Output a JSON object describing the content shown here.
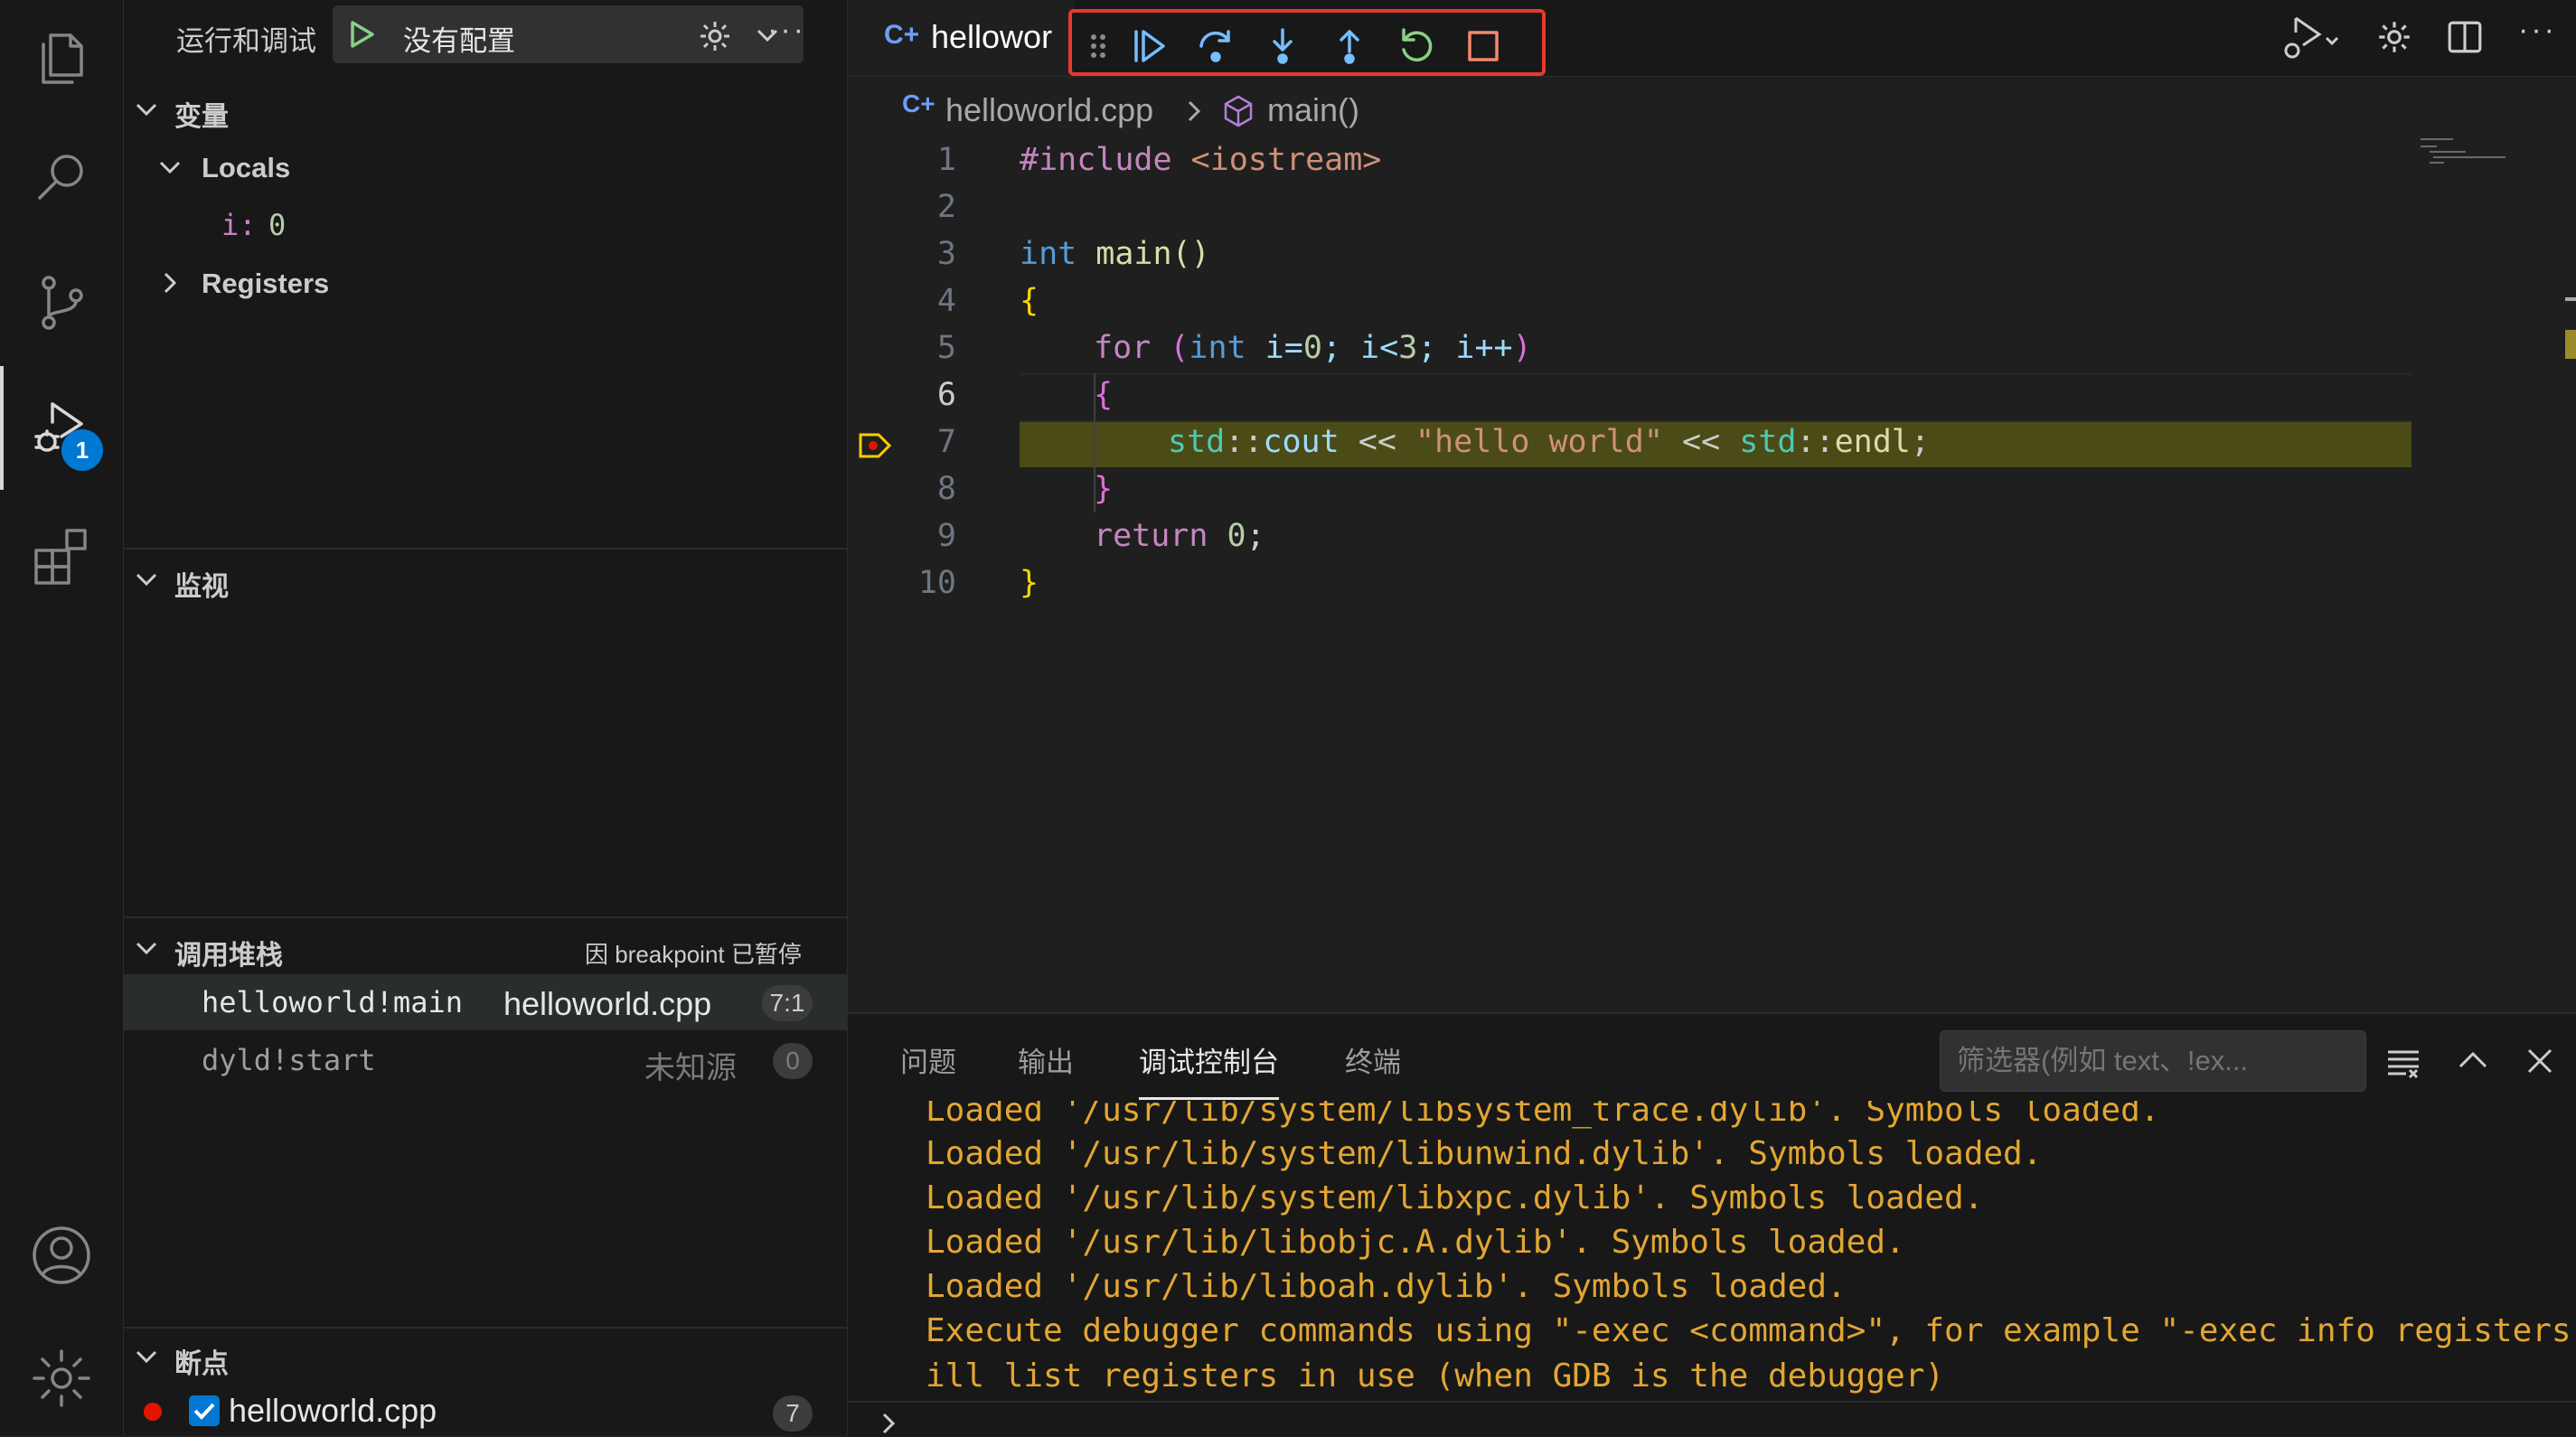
{
  "sidebar": {
    "run_title": "运行和调试",
    "config_label": "没有配置",
    "variables_title": "变量",
    "locals_label": "Locals",
    "var_name": "i:",
    "var_value": "0",
    "registers_label": "Registers",
    "watch_title": "监视",
    "callstack_title": "调用堆栈",
    "callstack_status": "因 breakpoint 已暂停",
    "frames": [
      {
        "name": "helloworld!main",
        "file": "helloworld.cpp",
        "pos": "7:1"
      },
      {
        "name": "dyld!start",
        "file": "未知源",
        "pos": "0"
      }
    ],
    "breakpoints_title": "断点",
    "breakpoint_file": "helloworld.cpp",
    "breakpoint_line": "7"
  },
  "activity": {
    "debug_badge": "1"
  },
  "editor": {
    "tab_label": "hellowor",
    "breadcrumb_file": "helloworld.cpp",
    "breadcrumb_symbol": "main()",
    "line_numbers": [
      "1",
      "2",
      "3",
      "4",
      "5",
      "6",
      "7",
      "8",
      "9",
      "10"
    ],
    "code": {
      "l1_a": "#include ",
      "l1_b": "<iostream>",
      "l3_a": "int",
      "l3_b": " main()",
      "l4": "{",
      "l5_a": "for",
      "l5_b": " (",
      "l5_c": "int",
      "l5_d": " i=",
      "l5_e": "0",
      "l5_f": "; i<",
      "l5_g": "3",
      "l5_h": "; i++",
      "l5_i": ")",
      "l6": "{",
      "l7_a": "std",
      "l7_b": "::",
      "l7_c": "cout",
      "l7_d": " << ",
      "l7_e": "\"hello world\"",
      "l7_f": " << ",
      "l7_g": "std",
      "l7_h": "::",
      "l7_i": "endl",
      "l7_j": ";",
      "l8": "}",
      "l9_a": "return",
      "l9_b": " ",
      "l9_c": "0",
      "l9_d": ";",
      "l10": "}"
    }
  },
  "panel": {
    "tabs": [
      "问题",
      "输出",
      "调试控制台",
      "终端"
    ],
    "filter_placeholder": "筛选器(例如 text、!ex...",
    "console_lines": [
      "Loaded '/usr/lib/system/libsystem_trace.dylib'. Symbols loaded.",
      "Loaded '/usr/lib/system/libunwind.dylib'. Symbols loaded.",
      "Loaded '/usr/lib/system/libxpc.dylib'. Symbols loaded.",
      "Loaded '/usr/lib/libobjc.A.dylib'. Symbols loaded.",
      "Loaded '/usr/lib/liboah.dylib'. Symbols loaded.",
      "Execute debugger commands using \"-exec <command>\", for example \"-exec info registers\" w",
      "ill list registers in use (when GDB is the debugger)"
    ]
  },
  "colors": {
    "debug_blue": "#75beff",
    "restart_green": "#89d185",
    "stop_red": "#f48771",
    "highlight_line": "#4b4b18",
    "console_text": "#e2a633",
    "toolbar_outline": "#e8392c"
  }
}
